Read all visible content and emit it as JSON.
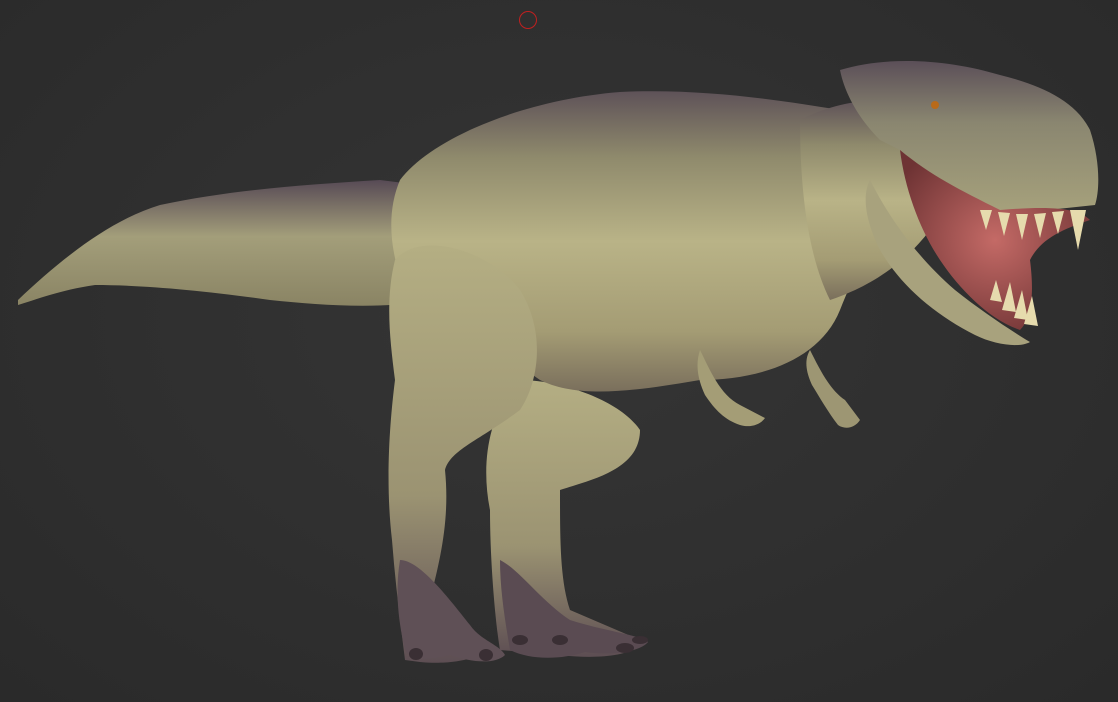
{
  "viewport": {
    "background_color": "#2f2f2f",
    "cursor_color": "#c02020",
    "cursor_icon": "brush-circle-icon"
  },
  "model": {
    "skin_color": "#b3ad82",
    "shadow_color": "#5a4c4e",
    "mouth_color": "#b05a5a",
    "teeth_color": "#e8dcae"
  }
}
